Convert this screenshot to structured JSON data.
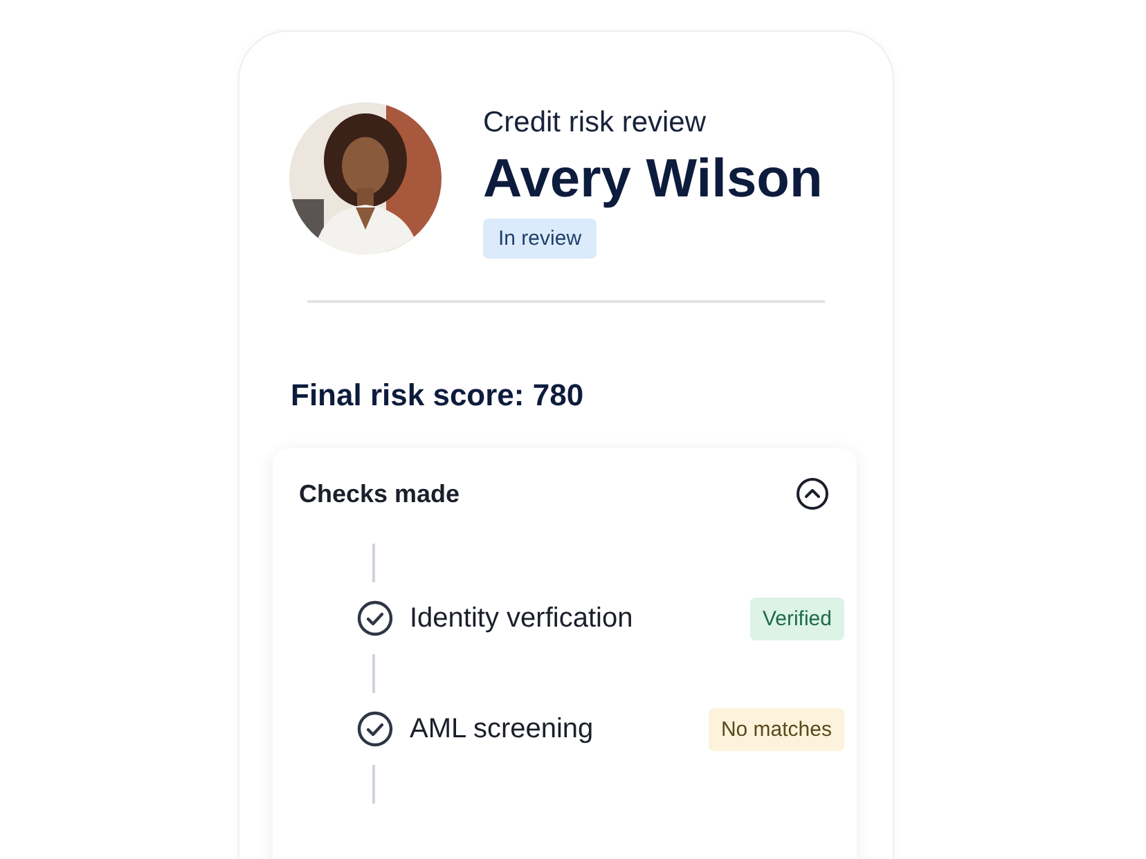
{
  "header": {
    "subtitle": "Credit risk review",
    "name": "Avery Wilson",
    "status": {
      "label": "In review",
      "color": "#dcebfb"
    }
  },
  "score": {
    "label": "Final risk score: 780"
  },
  "checks": {
    "title": "Checks made",
    "expanded": true,
    "items": [
      {
        "label": "Identity verfication",
        "checked": true,
        "badge": "Verified",
        "color": "#dcf3e6"
      },
      {
        "label": "AML screening",
        "checked": true,
        "badge": "No matches",
        "color": "#fdf3dc"
      }
    ]
  }
}
